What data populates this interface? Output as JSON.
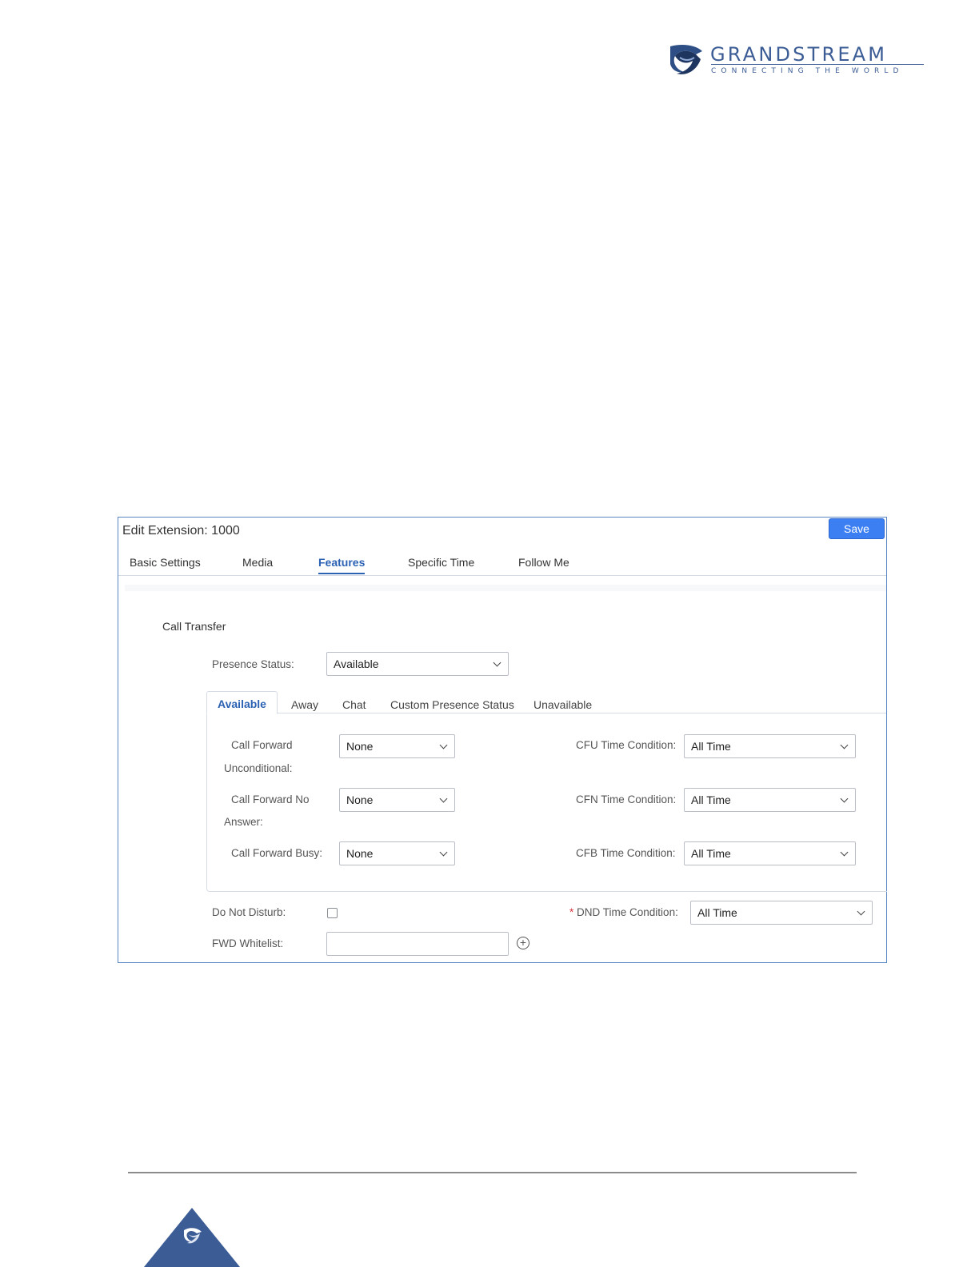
{
  "brand": {
    "name": "GRANDSTREAM",
    "tagline": "CONNECTING THE WORLD",
    "color": "#3b5c95"
  },
  "dialog": {
    "title": "Edit Extension: 1000",
    "save_label": "Save",
    "tabs": [
      {
        "label": "Basic Settings",
        "active": false
      },
      {
        "label": "Media",
        "active": false
      },
      {
        "label": "Features",
        "active": true
      },
      {
        "label": "Specific Time",
        "active": false
      },
      {
        "label": "Follow Me",
        "active": false
      }
    ],
    "section_title": "Call Transfer",
    "presence_status": {
      "label": "Presence Status:",
      "value": "Available"
    },
    "presence_tabs": [
      {
        "label": "Available",
        "active": true
      },
      {
        "label": "Away",
        "active": false
      },
      {
        "label": "Chat",
        "active": false
      },
      {
        "label": "Custom Presence Status",
        "active": false
      },
      {
        "label": "Unavailable",
        "active": false
      }
    ],
    "forward_rows": [
      {
        "label_line1": "Call Forward",
        "label_line2": "Unconditional:",
        "value": "None",
        "time_label": "CFU Time Condition:",
        "time_value": "All Time"
      },
      {
        "label_line1": "Call Forward No",
        "label_line2": "Answer:",
        "value": "None",
        "time_label": "CFN Time Condition:",
        "time_value": "All Time"
      },
      {
        "label_line1": "Call Forward Busy:",
        "label_line2": "",
        "value": "None",
        "time_label": "CFB Time Condition:",
        "time_value": "All Time"
      }
    ],
    "dnd": {
      "label": "Do Not Disturb:",
      "checked": false,
      "required_mark": "*",
      "time_label": "DND Time Condition:",
      "time_value": "All Time"
    },
    "fwd_whitelist": {
      "label": "FWD Whitelist:",
      "value": "",
      "add_icon": "plus-circle-icon"
    }
  },
  "colors": {
    "accent": "#2b62b3",
    "save_button": "#3b7ff2",
    "frame_border": "#5a86c4",
    "required": "#d9363e"
  }
}
